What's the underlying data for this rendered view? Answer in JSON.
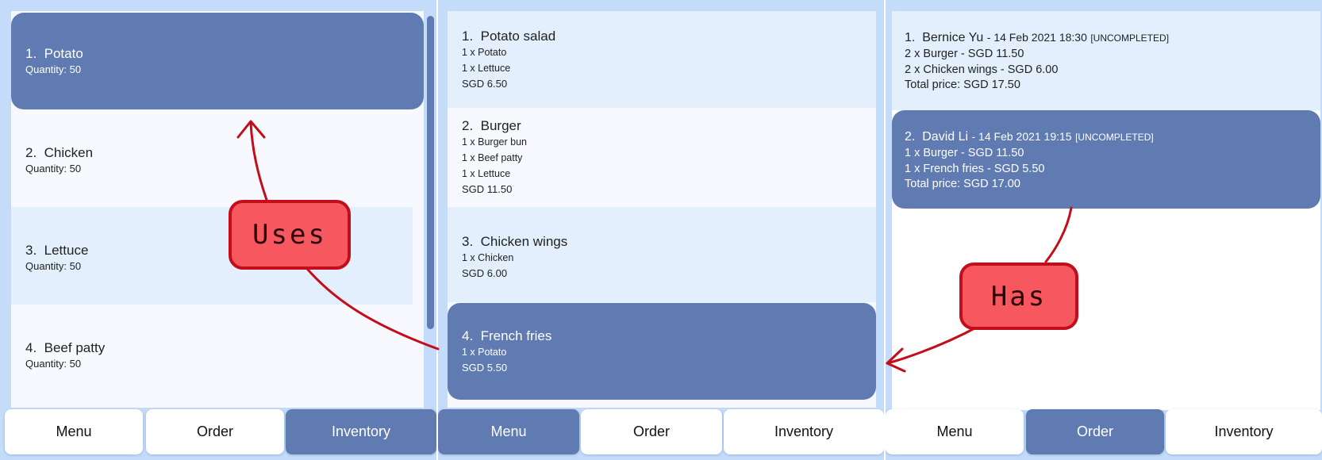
{
  "inventory_panel": {
    "items": [
      {
        "index": "1.",
        "name": "Potato",
        "quantity": "Quantity: 50"
      },
      {
        "index": "2.",
        "name": "Chicken",
        "quantity": "Quantity: 50"
      },
      {
        "index": "3.",
        "name": "Lettuce",
        "quantity": "Quantity: 50"
      },
      {
        "index": "4.",
        "name": "Beef patty",
        "quantity": "Quantity: 50"
      }
    ],
    "tabs": [
      "Menu",
      "Order",
      "Inventory"
    ],
    "active_tab": "Inventory"
  },
  "menu_panel": {
    "items": [
      {
        "index": "1.",
        "name": "Potato salad",
        "ingredients": [
          "1 x Potato",
          "1 x Lettuce"
        ],
        "price": "SGD 6.50"
      },
      {
        "index": "2.",
        "name": "Burger",
        "ingredients": [
          "1 x Burger bun",
          "1 x Beef patty",
          "1 x Lettuce"
        ],
        "price": "SGD 11.50"
      },
      {
        "index": "3.",
        "name": "Chicken wings",
        "ingredients": [
          "1 x Chicken"
        ],
        "price": "SGD 6.00"
      },
      {
        "index": "4.",
        "name": "French fries",
        "ingredients": [
          "1 x Potato"
        ],
        "price": "SGD 5.50"
      }
    ],
    "tabs": [
      "Menu",
      "Order",
      "Inventory"
    ],
    "active_tab": "Menu"
  },
  "order_panel": {
    "orders": [
      {
        "index": "1.",
        "customer": "Bernice Yu",
        "date": "- 14 Feb 2021 18:30",
        "status": "[UNCOMPLETED]",
        "lines": [
          "2 x Burger - SGD 11.50",
          "2 x Chicken wings - SGD 6.00"
        ],
        "total": "Total price: SGD 17.50"
      },
      {
        "index": "2.",
        "customer": "David Li",
        "date": "- 14 Feb 2021 19:15",
        "status": "[UNCOMPLETED]",
        "lines": [
          "1 x Burger - SGD 11.50",
          "1 x French fries - SGD 5.50"
        ],
        "total": "Total price: SGD 17.00"
      }
    ],
    "tabs": [
      "Menu",
      "Order",
      "Inventory"
    ],
    "active_tab": "Order"
  },
  "annotations": {
    "uses_label": "Uses",
    "has_label": "Has",
    "arrow_color": "#c30d1a",
    "callout_fill": "#f7585f"
  },
  "colors": {
    "selected": "#5f7bb1",
    "panel_bg": "#c4dcfa",
    "row_light": "#e3effd",
    "row_white": "#f8f9fe"
  }
}
